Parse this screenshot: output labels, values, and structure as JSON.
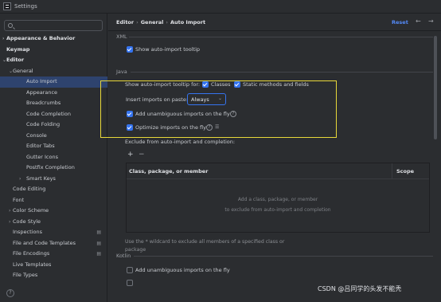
{
  "window": {
    "title": "Settings"
  },
  "tree": [
    {
      "label": "Appearance & Behavior",
      "level": 0,
      "arrow": "›",
      "bold": true
    },
    {
      "label": "Keymap",
      "level": 0,
      "bold": true
    },
    {
      "label": "Editor",
      "level": 0,
      "arrow": "⌄",
      "bold": true
    },
    {
      "label": "General",
      "level": 1,
      "arrow": "⌄"
    },
    {
      "label": "Auto Import",
      "level": 2,
      "selected": true
    },
    {
      "label": "Appearance",
      "level": 2
    },
    {
      "label": "Breadcrumbs",
      "level": 2
    },
    {
      "label": "Code Completion",
      "level": 2
    },
    {
      "label": "Code Folding",
      "level": 2
    },
    {
      "label": "Console",
      "level": 2
    },
    {
      "label": "Editor Tabs",
      "level": 2
    },
    {
      "label": "Gutter Icons",
      "level": 2
    },
    {
      "label": "Postfix Completion",
      "level": 2
    },
    {
      "label": "Smart Keys",
      "level": 2,
      "arrow": "›"
    },
    {
      "label": "Code Editing",
      "level": 1
    },
    {
      "label": "Font",
      "level": 1
    },
    {
      "label": "Color Scheme",
      "level": 1,
      "arrow": "›"
    },
    {
      "label": "Code Style",
      "level": 1,
      "arrow": "›"
    },
    {
      "label": "Inspections",
      "level": 1,
      "badge": true
    },
    {
      "label": "File and Code Templates",
      "level": 1,
      "badge": true
    },
    {
      "label": "File Encodings",
      "level": 1,
      "badge": true
    },
    {
      "label": "Live Templates",
      "level": 1
    },
    {
      "label": "File Types",
      "level": 1
    }
  ],
  "header": {
    "crumbs": [
      "Editor",
      "General",
      "Auto Import"
    ],
    "separator": "›",
    "reset": "Reset",
    "back": "←",
    "forward": "→"
  },
  "xml": {
    "section": "XML",
    "show_tooltip": "Show auto-import tooltip"
  },
  "java": {
    "section": "Java",
    "show_tooltip_for": "Show auto-import tooltip for:",
    "classes": "Classes",
    "static_methods": "Static methods and fields",
    "insert_on_paste": "Insert imports on paste:",
    "insert_value": "Always",
    "add_unambiguous": "Add unambiguous imports on the fly",
    "optimize": "Optimize imports on the fly",
    "exclude_label": "Exclude from auto-import and completion:",
    "add_btn": "+",
    "remove_btn": "−",
    "col_class": "Class, package, or member",
    "col_scope": "Scope",
    "empty_line1": "Add a class, package, or member",
    "empty_line2": "to exclude from auto-import and completion",
    "hint": "Use the * wildcard to exclude all members of a specified class or package"
  },
  "kotlin": {
    "section": "Kotlin",
    "add_unambiguous": "Add unambiguous imports on the fly"
  },
  "watermark": "CSDN @吕同学的头发不能秃",
  "help_glyph": "?",
  "colors": {
    "accent": "#3574f0",
    "highlight_box": "#e8d83a",
    "selected_row": "#2e436e",
    "link": "#548af7"
  }
}
